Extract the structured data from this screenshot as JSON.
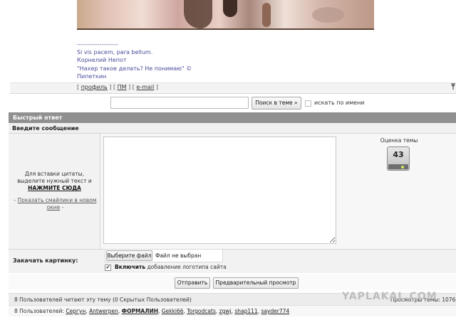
{
  "post": {
    "signature": [
      "--------------------",
      "Si vis pacem, para bellum.",
      "Корнелий Непот",
      "\"Нахер такое делать? Не понимаю\" ©",
      "Пипеткин"
    ],
    "links": {
      "open1": "[ ",
      "profile": "профиль",
      "sep1": " ] [ ",
      "pm": "ПМ",
      "sep2": " ] [ ",
      "email": "e-mail",
      "close": " ]"
    },
    "up_icon": "arrow-up-icon"
  },
  "search": {
    "value": "",
    "button_label": "Поиск в теме »",
    "by_name_label": "искать по имени"
  },
  "quick_reply": {
    "title": "Быстрый ответ",
    "enter_message_label": "Введите сообщение",
    "quote_hint_1": "Для вставки цитаты,",
    "quote_hint_2": "выделите нужный текст и",
    "quote_hint_link": "НАЖМИТЕ СЮДА",
    "smiles_prefix": "- ",
    "smiles_link": "Показать смайлики в новом окне",
    "smiles_suffix": " -",
    "message_value": "",
    "rating_label": "Оценка темы",
    "rating_value": "43"
  },
  "upload": {
    "label": "Закачать картинку:",
    "choose_button": "Выберите файл",
    "file_status": "Файл не выбран",
    "logo_checked": "✔",
    "logo_bold": "Включить",
    "logo_rest": " добавление логотипа сайта"
  },
  "actions": {
    "send": "Отправить",
    "preview": "Предварительный просмотр"
  },
  "stats": {
    "readers": "8 Пользователей читают эту тему (0 Скрытых Пользователей)",
    "right_text": "Просмотры темы: 1076",
    "watermark": "YAPLAKAL.COM",
    "users_prefix": "8 Пользователей: ",
    "users": [
      {
        "name": "Сергун",
        "bold": false
      },
      {
        "name": "Antwerpen",
        "bold": false
      },
      {
        "name": "ФОРМАЛИН",
        "bold": true
      },
      {
        "name": "Gekki66",
        "bold": false
      },
      {
        "name": "Torgodcats",
        "bold": false
      },
      {
        "name": "zgwj",
        "bold": false
      },
      {
        "name": "shap111",
        "bold": false
      },
      {
        "name": "sayder774",
        "bold": false
      }
    ]
  }
}
